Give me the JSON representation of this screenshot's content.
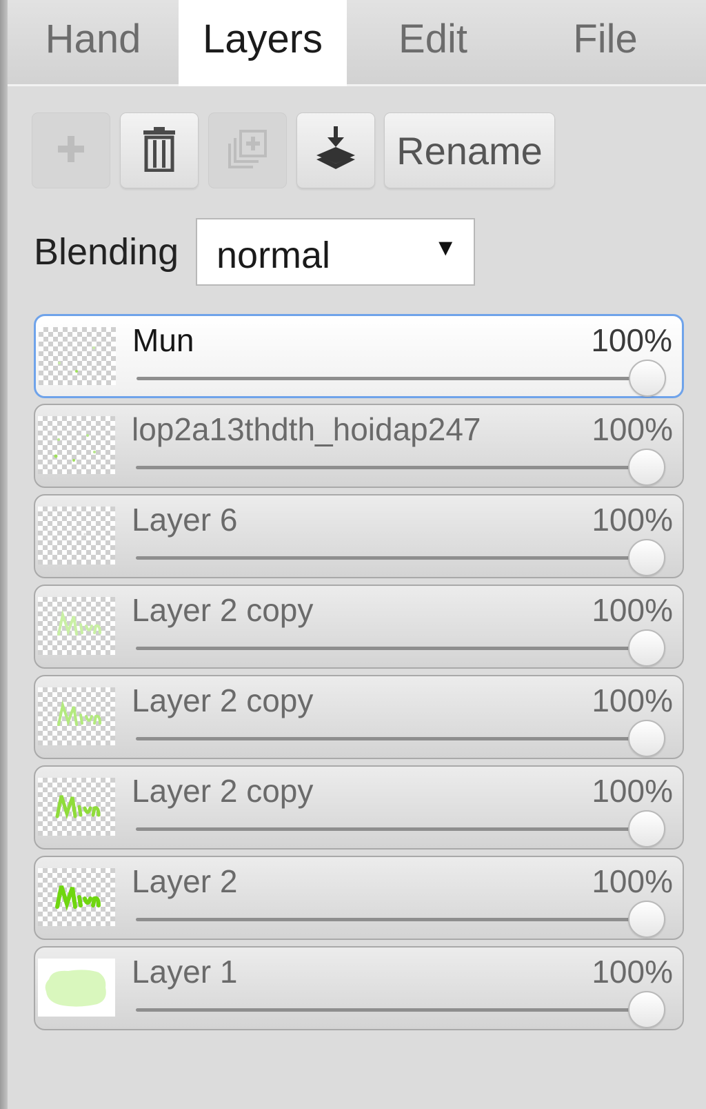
{
  "tabs": [
    {
      "label": "Hand",
      "active": false
    },
    {
      "label": "Layers",
      "active": true
    },
    {
      "label": "Edit",
      "active": false
    },
    {
      "label": "File",
      "active": false
    }
  ],
  "toolbar": {
    "add_icon": "plus-icon",
    "delete_icon": "trash-icon",
    "duplicate_icon": "duplicate-icon",
    "merge_down_icon": "merge-down-icon",
    "rename_label": "Rename"
  },
  "blending": {
    "label": "Blending",
    "value": "normal",
    "caret": "▼"
  },
  "layers": [
    {
      "name": "Mun",
      "opacity": "100%",
      "opacity_value": 1.0,
      "selected": true
    },
    {
      "name": "lop2a13thdth_hoidap247",
      "opacity": "100%",
      "opacity_value": 1.0,
      "selected": false
    },
    {
      "name": "Layer 6",
      "opacity": "100%",
      "opacity_value": 1.0,
      "selected": false
    },
    {
      "name": "Layer 2 copy",
      "opacity": "100%",
      "opacity_value": 1.0,
      "selected": false
    },
    {
      "name": "Layer 2 copy",
      "opacity": "100%",
      "opacity_value": 1.0,
      "selected": false
    },
    {
      "name": "Layer 2 copy",
      "opacity": "100%",
      "opacity_value": 1.0,
      "selected": false
    },
    {
      "name": "Layer 2",
      "opacity": "100%",
      "opacity_value": 1.0,
      "selected": false
    },
    {
      "name": "Layer 1",
      "opacity": "100%",
      "opacity_value": 1.0,
      "selected": false
    }
  ],
  "colors": {
    "selected_border": "#6fa3ea",
    "thumb_green": "#7de01c",
    "thumb_light_green": "#d9f7bd"
  }
}
